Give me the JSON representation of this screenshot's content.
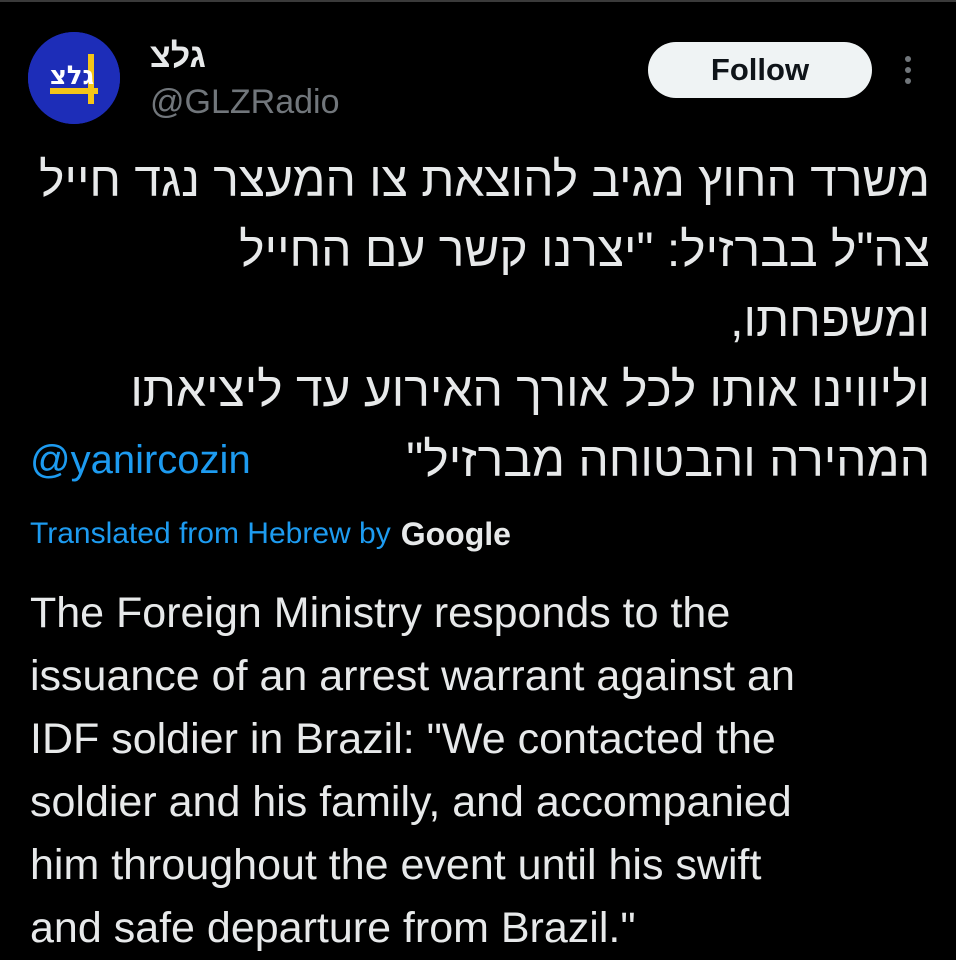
{
  "tweet": {
    "author": {
      "display_name": "גלצ",
      "handle": "@GLZRadio",
      "avatar_text": "גלצ",
      "avatar_colors": {
        "background": "#1d2db8",
        "accent": "#f5c518"
      }
    },
    "follow_label": "Follow",
    "more_icon": "more-vertical-icon",
    "text_hebrew": "משרד החוץ מגיב להוצאת צו המעצר נגד חייל\nצה\"ל בברזיל: \"יצרנו קשר עם החייל ומשפחתו,\nוליווינו אותו לכל אורך האירוע עד ליציאתו\nהמהירה והבטוחה מברזיל\"",
    "mention": "@yanircozin",
    "translated_label": "Translated from Hebrew by",
    "translation_provider": "Google",
    "text_english": "The Foreign Ministry responds to the\nissuance of an arrest warrant against an\nIDF soldier in Brazil: \"We contacted the\nsoldier and his family, and accompanied\nhim throughout the event until his swift\nand safe departure from Brazil.\""
  },
  "colors": {
    "background": "#000000",
    "text_primary": "#e7e9ea",
    "text_secondary": "#71767b",
    "link_blue": "#1d9bf0",
    "button_bg": "#eff3f4"
  }
}
